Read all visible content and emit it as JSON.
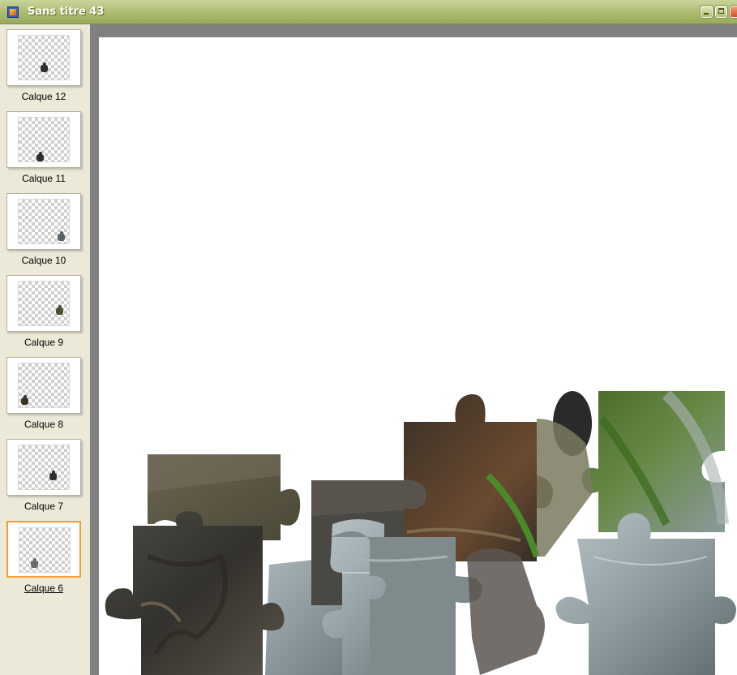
{
  "window": {
    "title": "Sans titre 43",
    "app_icon": "image-window-icon",
    "controls": [
      "minimize",
      "maximize",
      "close"
    ]
  },
  "layers": [
    {
      "name": "Calque 12",
      "selected": false
    },
    {
      "name": "Calque 11",
      "selected": false
    },
    {
      "name": "Calque 10",
      "selected": false
    },
    {
      "name": "Calque 9",
      "selected": false
    },
    {
      "name": "Calque 8",
      "selected": false
    },
    {
      "name": "Calque 7",
      "selected": false
    },
    {
      "name": "Calque 6",
      "selected": true
    }
  ],
  "colors": {
    "titlebar": "#a9ba6c",
    "panel": "#ece9d8",
    "selection": "#f0a030",
    "canvas": "#ffffff"
  }
}
